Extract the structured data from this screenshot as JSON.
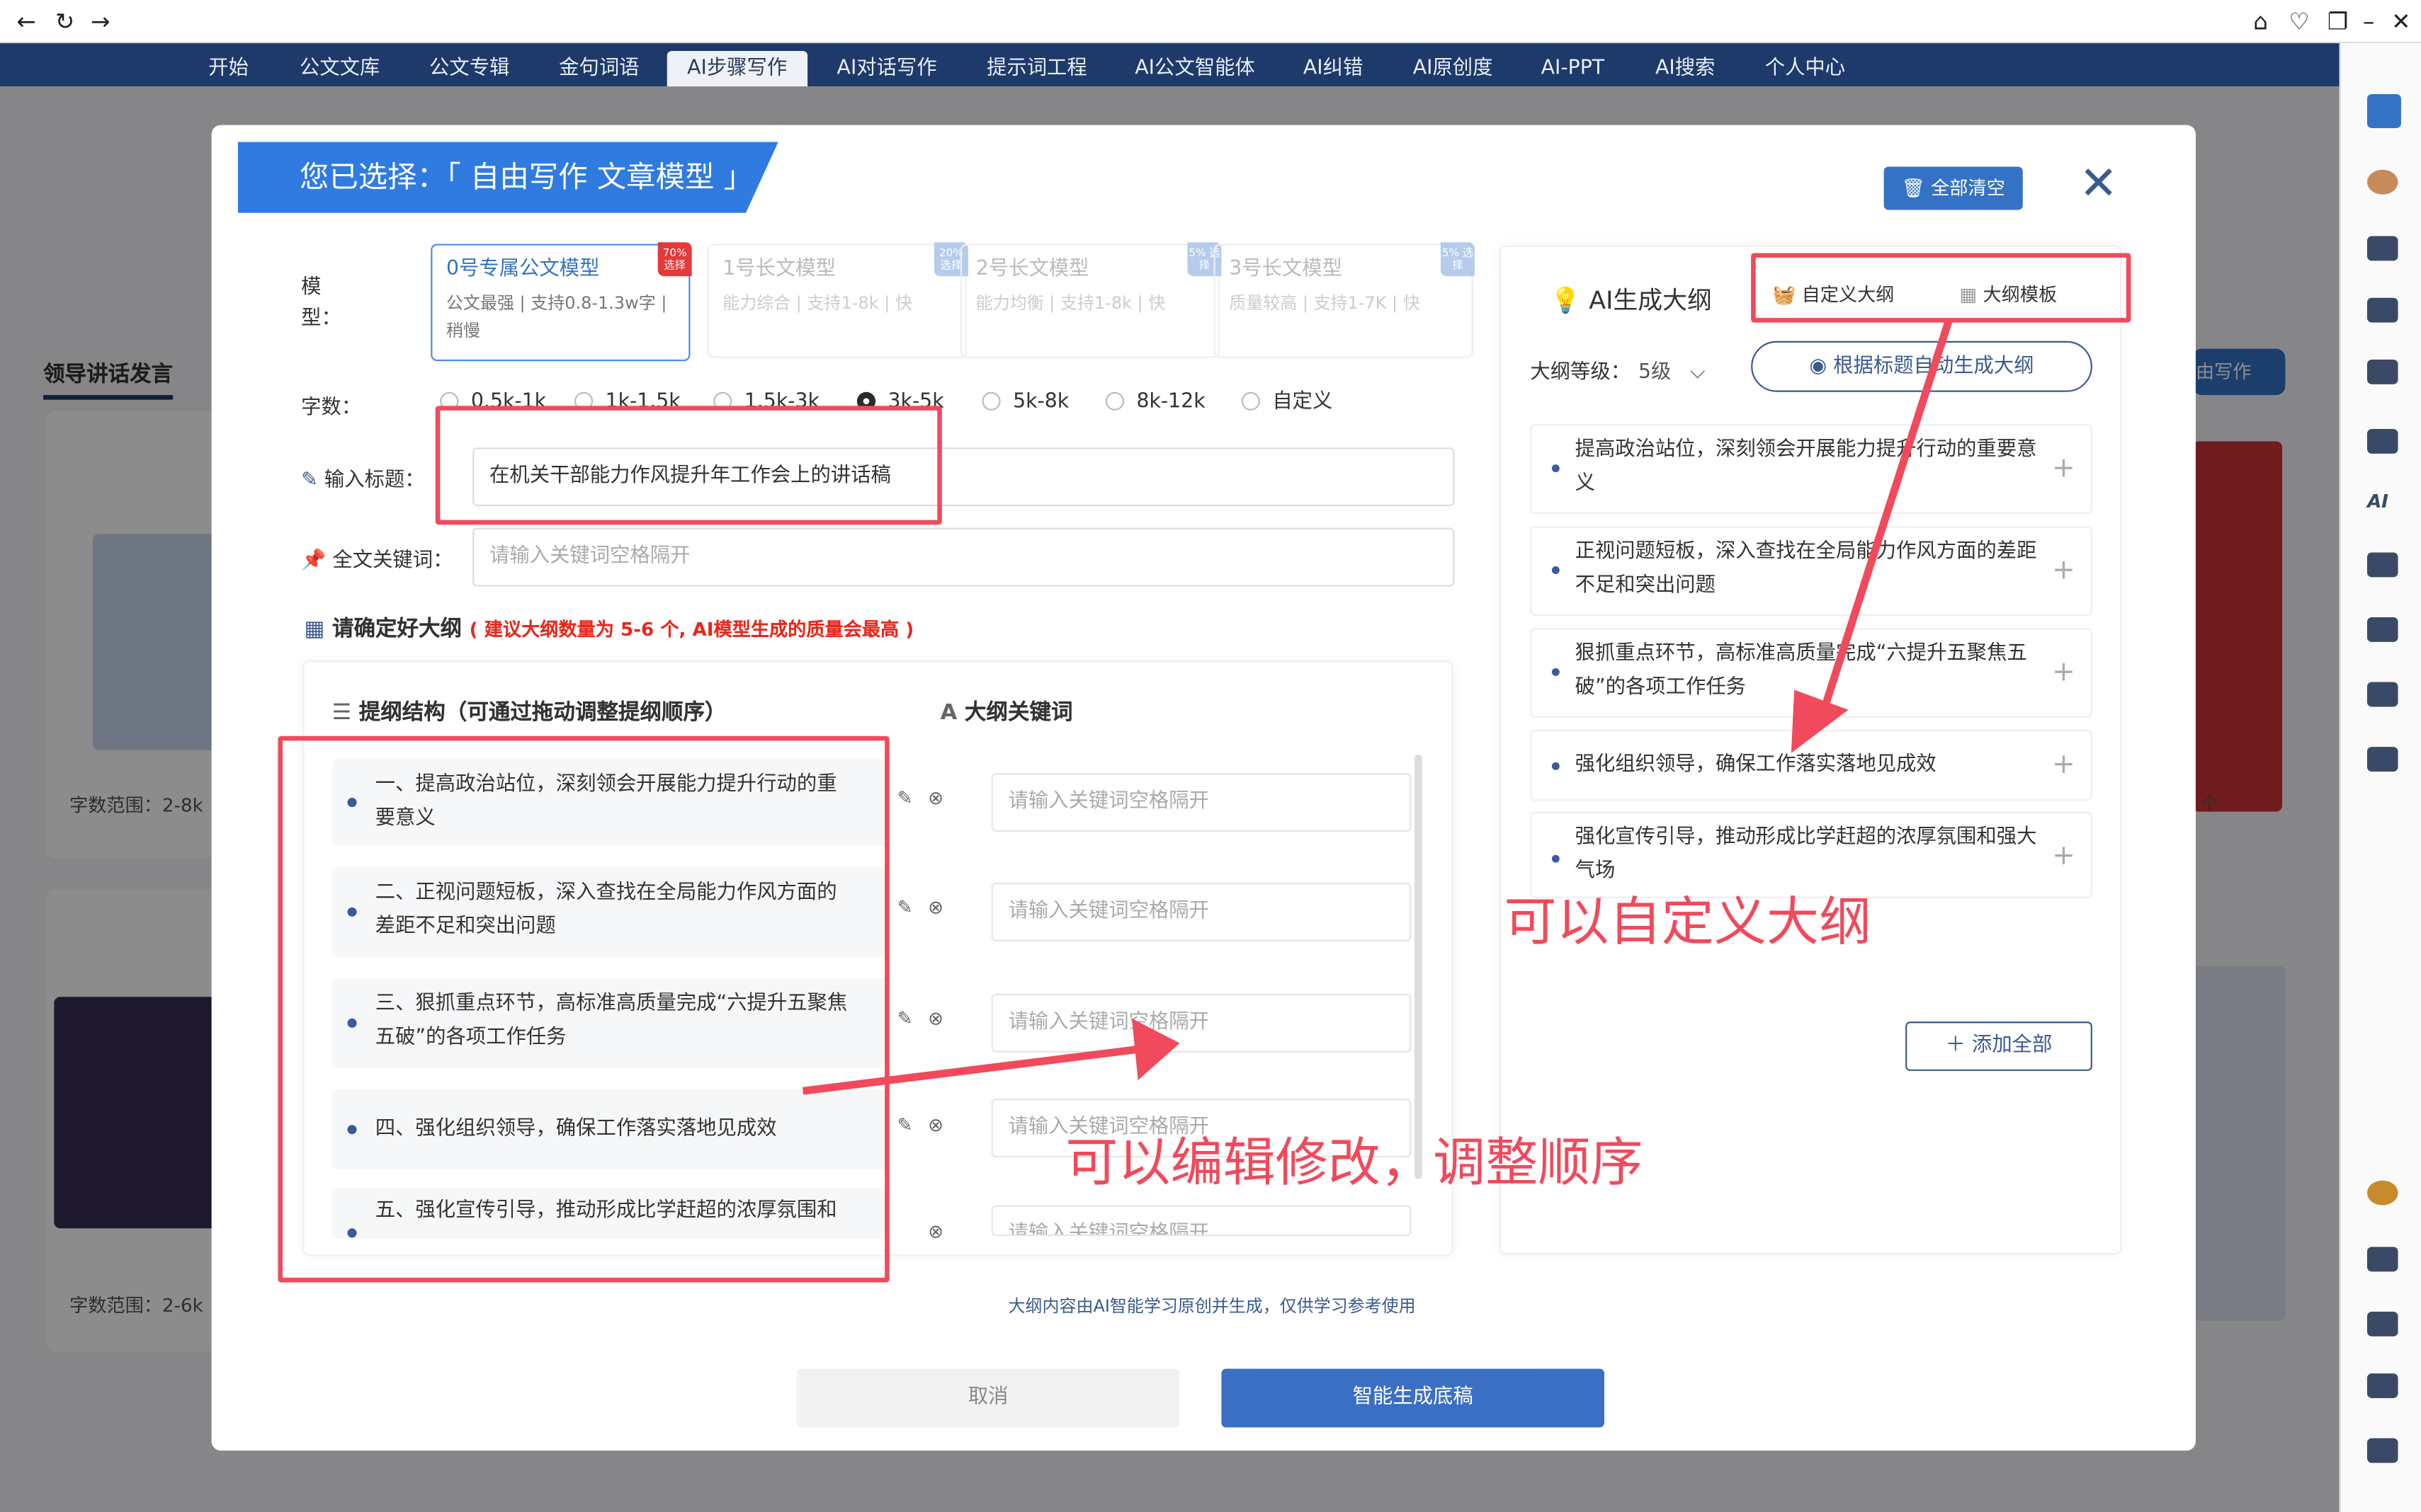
{
  "browser": {
    "icons": [
      "back-icon",
      "refresh-icon",
      "forward-icon",
      "home-icon",
      "heart-icon",
      "window-icon",
      "minimize-icon",
      "close-icon"
    ]
  },
  "nav": {
    "tabs": [
      "开始",
      "公文文库",
      "公文专辑",
      "金句词语",
      "AI步骤写作",
      "AI对话写作",
      "提示词工程",
      "AI公文智能体",
      "AI纠错",
      "AI原创度",
      "AI-PPT",
      "AI搜索",
      "个人中心"
    ],
    "active_index": 4
  },
  "background": {
    "section_title": "领导讲话发言",
    "word_range_1": "字数范围：2-8k",
    "word_range_2": "字数范围：2-6k",
    "right_button": "由写作",
    "right_suffix": "个"
  },
  "modal": {
    "title": "您已选择：「 自由写作 文章模型 」",
    "clear_all": "全部清空",
    "model_label": "模型：",
    "models": [
      {
        "name": "0号专属公文模型",
        "desc": "公文最强 | 支持0.8-1.3w字 | 稍慢",
        "badge": "70% 选择",
        "selected": true
      },
      {
        "name": "1号长文模型",
        "desc": "能力综合 | 支持1-8k | 快",
        "badge": "20% 选择",
        "selected": false
      },
      {
        "name": "2号长文模型",
        "desc": "能力均衡 | 支持1-8k | 快",
        "badge": "5% 选择",
        "selected": false
      },
      {
        "name": "3号长文模型",
        "desc": "质量较高 | 支持1-7K | 快",
        "badge": "5% 选择",
        "selected": false
      }
    ],
    "word_count_label": "字数：",
    "word_options": [
      "0.5k-1k",
      "1k-1.5k",
      "1.5k-3k",
      "3k-5k",
      "5k-8k",
      "8k-12k",
      "自定义"
    ],
    "word_selected_index": 3,
    "title_label": "输入标题：",
    "title_value": "在机关干部能力作风提升年工作会上的讲话稿",
    "keyword_label": "全文关键词：",
    "keyword_placeholder": "请输入关键词空格隔开",
    "outline_confirm": "请确定好大纲",
    "outline_tip": "( 建议大纲数量为 5-6 个, AI模型生成的质量会最高 )",
    "structure_header": "提纲结构（可通过拖动调整提纲顺序）",
    "keyword_header": "大纲关键词",
    "outline_items": [
      "一、提高政治站位，深刻领会开展能力提升行动的重要意义",
      "二、正视问题短板，深入查找在全局能力作风方面的差距不足和突出问题",
      "三、狠抓重点环节，高标准高质量完成“六提升五聚焦五破”的各项工作任务",
      "四、强化组织领导，确保工作落实落地见成效",
      "五、强化宣传引导，推动形成比学赶超的浓厚氛围和"
    ],
    "outline_kw_placeholder": "请输入关键词空格隔开",
    "ai_title": "AI生成大纲",
    "custom_tab": "自定义大纲",
    "template_tab": "大纲模板",
    "level_label": "大纲等级：",
    "level_value": "5级",
    "auto_generate": "根据标题自动生成大纲",
    "ai_items": [
      "提高政治站位，深刻领会开展能力提升行动的重要意义",
      "正视问题短板，深入查找在全局能力作风方面的差距不足和突出问题",
      "狠抓重点环节，高标准高质量完成“六提升五聚焦五破”的各项工作任务",
      "强化组织领导，确保工作落实落地见成效",
      "强化宣传引导，推动形成比学赶超的浓厚氛围和强大气场"
    ],
    "add_all": "添加全部",
    "footnote": "大纲内容由AI智能学习原创并生成，仅供学习参考使用",
    "cancel": "取消",
    "generate": "智能生成底稿"
  },
  "annotations": {
    "custom_outline": "可以自定义大纲",
    "edit_reorder": "可以编辑修改，调整顺序"
  },
  "colors": {
    "primary": "#3472c6",
    "nav": "#1d3a6a",
    "annotation": "#f04a5c",
    "warning": "#e8271c"
  }
}
